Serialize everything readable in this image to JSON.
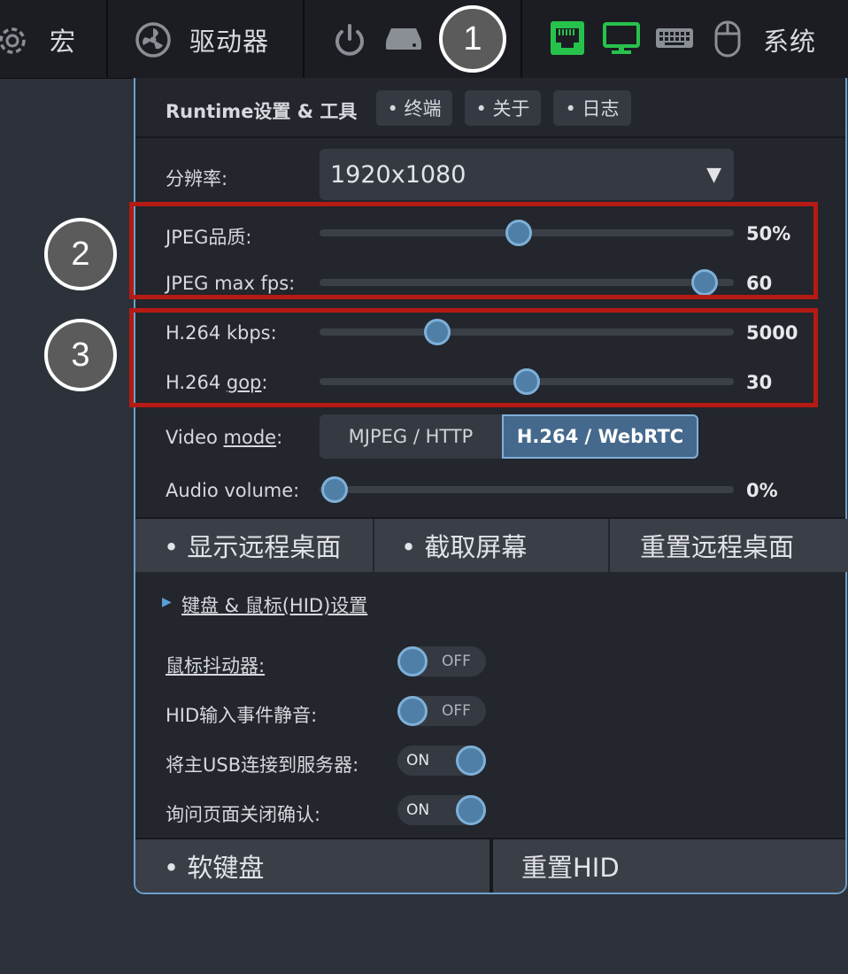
{
  "menubar": {
    "macro_label": "宏",
    "drives_label": "驱动器",
    "system_label": "系统",
    "badge_1": "1",
    "icons": [
      "gear-icon",
      "fan-icon",
      "power-icon",
      "drive-icon",
      "ethernet-icon",
      "monitor-icon",
      "keyboard-icon",
      "mouse-icon"
    ],
    "colors": {
      "active_green": "#27c24c",
      "inactive_gray": "#8a8e95"
    }
  },
  "panel": {
    "title": "Runtime设置 & 工具",
    "chips": [
      "• 终端",
      "• 关于",
      "• 日志"
    ],
    "resolution": {
      "label": "分辨率:",
      "value": "1920x1080",
      "arrow": "▼"
    },
    "sliders": {
      "jpeg_quality": {
        "label": "JPEG品质:",
        "value_text": "50%",
        "position": 0.48
      },
      "jpeg_fps": {
        "label": "JPEG max fps:",
        "value_text": "60",
        "position": 0.96
      },
      "h264_kbps": {
        "label": "H.264 kbps:",
        "value_text": "5000",
        "position": 0.27
      },
      "h264_gop": {
        "label_pre": "H.264 ",
        "label_u": "gop",
        "label_post": ":",
        "value_text": "30",
        "position": 0.5
      },
      "audio": {
        "label": "Audio volume:",
        "value_text": "0%",
        "position": 0.0
      }
    },
    "video_mode": {
      "label_pre": "Video ",
      "label_u": "mode",
      "label_post": ":",
      "options": [
        "MJPEG / HTTP",
        "H.264 / WebRTC"
      ],
      "selected": 1
    },
    "actions": [
      "• 显示远程桌面",
      "• 截取屏幕",
      "重置远程桌面"
    ],
    "hid_settings_link": "键盘 & 鼠标(HID)设置",
    "hid_arrow": "▶",
    "toggles": [
      {
        "label": "鼠标抖动器:",
        "state": "OFF",
        "underline": true
      },
      {
        "label": "HID输入事件静音:",
        "state": "OFF",
        "underline": false
      },
      {
        "label": "将主USB连接到服务器:",
        "state": "ON",
        "underline": false
      },
      {
        "label": "询问页面关闭确认:",
        "state": "ON",
        "underline": false
      }
    ],
    "bottom_buttons": [
      "• 软键盘",
      "重置HID"
    ],
    "badges": [
      "2",
      "3"
    ]
  }
}
